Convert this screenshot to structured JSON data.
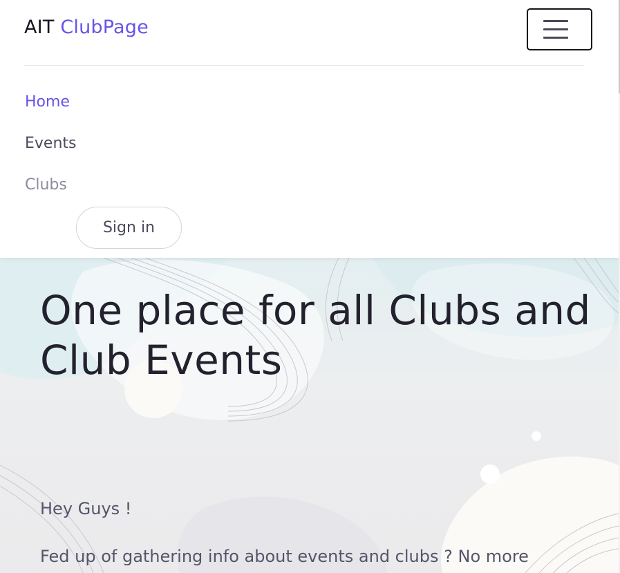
{
  "header": {
    "brand_prefix": "AIT",
    "brand_name": "ClubPage",
    "toggler_icon": "hamburger-menu-icon"
  },
  "nav": {
    "items": [
      {
        "label": "Home",
        "state": "active"
      },
      {
        "label": "Events",
        "state": "default"
      },
      {
        "label": "Clubs",
        "state": "muted"
      }
    ],
    "signin_label": "Sign in"
  },
  "hero": {
    "title": "One place for all Clubs and Club Events",
    "greeting": "Hey Guys !",
    "body": "Fed up of gathering info about events and clubs ? No more scrolling , this website is solution to your"
  },
  "colors": {
    "accent": "#6654e8",
    "text_dark": "#23212e",
    "text_body": "#56546a",
    "nav_muted": "#8d8b9c"
  }
}
